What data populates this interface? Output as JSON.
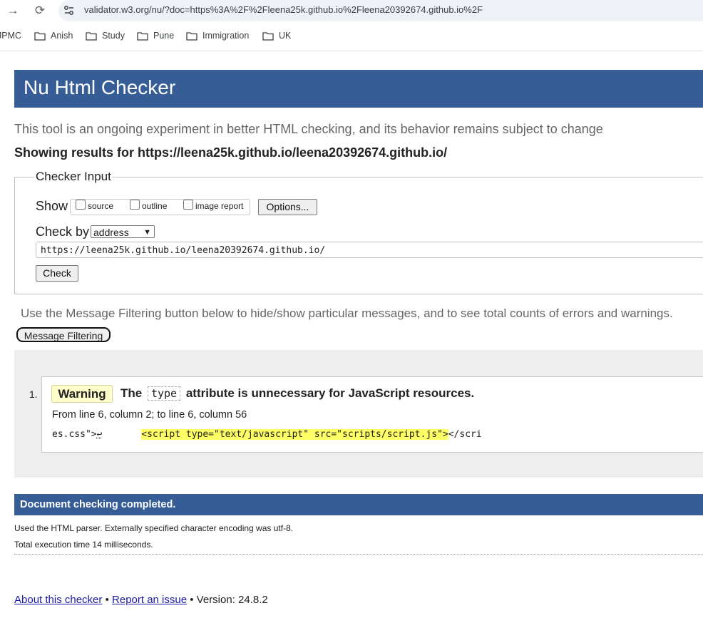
{
  "browser": {
    "url": "validator.w3.org/nu/?doc=https%3A%2F%2Fleena25k.github.io%2Fleena20392674.github.io%2F",
    "bookmarks": [
      "JPMC",
      "Anish",
      "Study",
      "Pune",
      "Immigration",
      "UK"
    ]
  },
  "page": {
    "title": "Nu Html Checker",
    "tagline": "This tool is an ongoing experiment in better HTML checking, and its behavior remains subject to change",
    "showing_results": "Showing results for https://leena25k.github.io/leena20392674.github.io/"
  },
  "checker_input": {
    "legend": "Checker Input",
    "show_label": "Show",
    "show_options": [
      {
        "label": "source",
        "checked": false
      },
      {
        "label": "outline",
        "checked": false
      },
      {
        "label": "image report",
        "checked": false
      }
    ],
    "options_button": "Options...",
    "check_by_label": "Check by",
    "check_by_value": "address",
    "url_value": "https://leena25k.github.io/leena20392674.github.io/",
    "check_button": "Check"
  },
  "filtering": {
    "note": "Use the Message Filtering button below to hide/show particular messages, and to see total counts of errors and warnings.",
    "button": "Message Filtering"
  },
  "messages": [
    {
      "number": "1.",
      "type": "Warning",
      "text_before": "The",
      "code": "type",
      "text_after": "attribute is unnecessary for JavaScript resources.",
      "location": "From line 6, column 2; to line 6, column 56",
      "extract_before": "es.css\">",
      "line_feed": "↩",
      "extract_highlight": "<script type=\"text/javascript\" src=\"scripts/script.js\">",
      "extract_after": "</scri"
    }
  ],
  "summary": {
    "completed": "Document checking completed.",
    "parser_info": "Used the HTML parser. Externally specified character encoding was utf-8.",
    "time_info": "Total execution time 14 milliseconds."
  },
  "footer": {
    "about": "About this checker",
    "sep1": "•",
    "report": "Report an issue",
    "version": "• Version: 24.8.2"
  },
  "colors": {
    "banner": "#365d95",
    "warning_badge": "#ffffcc",
    "highlight": "#ffff66",
    "link": "#1a1aa6"
  }
}
